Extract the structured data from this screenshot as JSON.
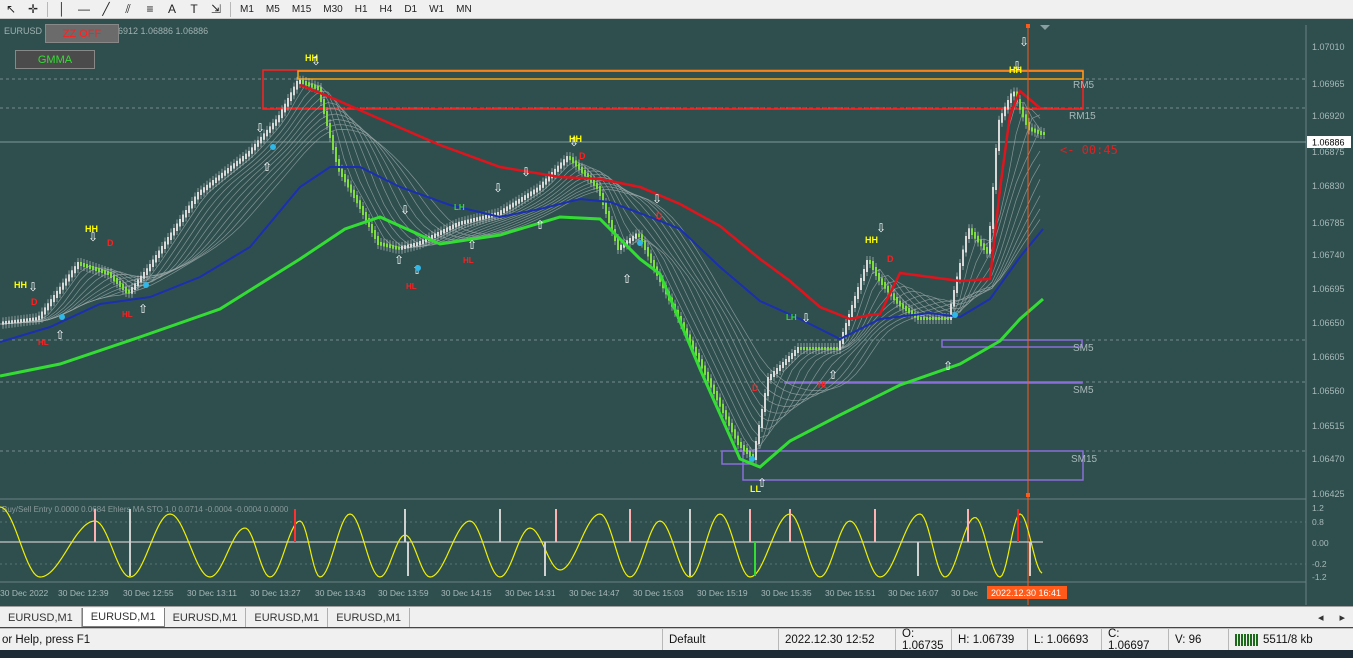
{
  "toolbar": {
    "tools": [
      {
        "name": "cursor-icon",
        "glyph": "↖"
      },
      {
        "name": "crosshair-icon",
        "glyph": "✛"
      },
      {
        "name": "vertical-line-icon",
        "glyph": "│"
      },
      {
        "name": "horizontal-line-icon",
        "glyph": "—"
      },
      {
        "name": "trendline-icon",
        "glyph": "╱"
      },
      {
        "name": "channel-icon",
        "glyph": "⫽"
      },
      {
        "name": "fibonacci-icon",
        "glyph": "≡"
      },
      {
        "name": "text-icon",
        "glyph": "A"
      },
      {
        "name": "text-label-icon",
        "glyph": "T"
      },
      {
        "name": "shapes-icon",
        "glyph": "⇲"
      }
    ],
    "timeframes": [
      "M1",
      "M5",
      "M15",
      "M30",
      "H1",
      "H4",
      "D1",
      "W1",
      "MN"
    ]
  },
  "chart": {
    "symbol_header": "EURUSD",
    "ohlc_header": "6912 1.06886 1.06886",
    "zz_button": "ZZ OFF",
    "gmma_button": "GMMA",
    "price_labels": [
      "1.07010",
      "1.06965",
      "1.06920",
      "1.06886",
      "1.06875",
      "1.06830",
      "1.06785",
      "1.06740",
      "1.06695",
      "1.06650",
      "1.06605",
      "1.06560",
      "1.06515",
      "1.06470",
      "1.06425"
    ],
    "current_price": "1.06886",
    "countdown": "<- 00:45",
    "zones": {
      "rm5": "RM5",
      "rm15": "RM15",
      "sm5a": "SM5",
      "sm5b": "SM5",
      "sm15": "SM15"
    },
    "markers": {
      "hh": "HH",
      "hl": "HL",
      "lh": "LH",
      "ll": "LL",
      "d": "D"
    },
    "sub_header": "Buy/Sell Entry 0.0000 0.0684  Ehlers MA STO 1.0 0.0714 -0.0004 -0.0004 0.0000",
    "sub_labels": [
      "1.2",
      "0.8",
      "0.00",
      "-0.2",
      "-1.2"
    ],
    "time_labels": [
      "30 Dec 2022",
      "30 Dec 12:39",
      "30 Dec 12:55",
      "30 Dec 13:11",
      "30 Dec 13:27",
      "30 Dec 13:43",
      "30 Dec 13:59",
      "30 Dec 14:15",
      "30 Dec 14:31",
      "30 Dec 14:47",
      "30 Dec 15:03",
      "30 Dec 15:19",
      "30 Dec 15:35",
      "30 Dec 15:51",
      "30 Dec 16:07",
      "30 Dec"
    ],
    "time_cursor": "2022.12.30 16:41"
  },
  "tabs": [
    "EURUSD,M1",
    "EURUSD,M1",
    "EURUSD,M1",
    "EURUSD,M1",
    "EURUSD,M1"
  ],
  "status": {
    "help": "or Help, press F1",
    "profile": "Default",
    "datetime": "2022.12.30 12:52",
    "open": "O: 1.06735",
    "high": "H: 1.06739",
    "low": "L: 1.06693",
    "close": "C: 1.06697",
    "volume": "V: 96",
    "traffic": "5511/8 kb"
  },
  "colors": {
    "bg": "#2f4f4f",
    "red_ma": "#e0141c",
    "blue_ma": "#1b2fb0",
    "green_ma": "#33dd33",
    "zone_orange": "#f2a417",
    "zone_red": "#ff2020",
    "zone_purple": "#8a6fd8",
    "osc_yellow": "#f0f000"
  }
}
